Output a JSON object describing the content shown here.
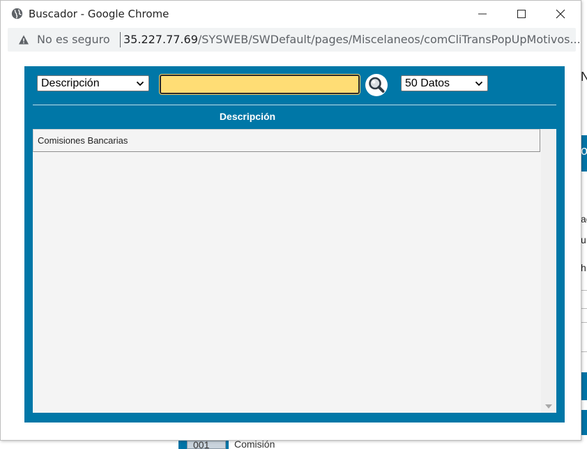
{
  "window": {
    "title": "Buscador - Google Chrome",
    "security_label": "No es seguro",
    "url_host": "35.227.77.69",
    "url_path": "/SYSWEB/SWDefault/pages/Miscelaneos/comCliTransPopUpMotivos..."
  },
  "search": {
    "field_select": "Descripción",
    "query": "",
    "count_select": "50 Datos"
  },
  "table": {
    "columns": [
      "Descripción"
    ],
    "rows": [
      {
        "descripcion": "Comisiones Bancarias"
      }
    ]
  },
  "background": {
    "row_code": "001",
    "row_label": "Comisión",
    "side_chars": [
      "N",
      "o",
      "ac",
      "u",
      "h"
    ]
  },
  "colors": {
    "panel": "#0077a7",
    "search_field": "#ffdd75"
  }
}
